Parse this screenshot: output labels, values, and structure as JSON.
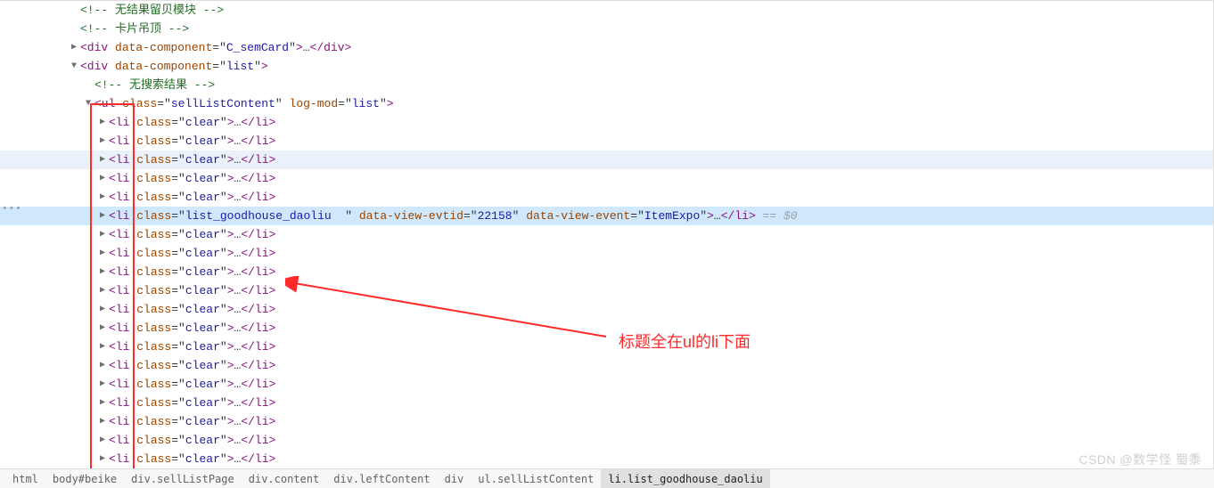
{
  "comments": {
    "c0": "<!-- 无结果留贝模块 -->",
    "c1": "<!-- 卡片吊顶 -->",
    "c2": "<!-- 无搜索结果 -->"
  },
  "nodes": {
    "div_sem": {
      "tag": "div",
      "attr": "data-component",
      "val": "C_semCard",
      "ell": "…",
      "close": "</div>"
    },
    "div_list": {
      "tag": "div",
      "attr": "data-component",
      "val": "list"
    },
    "ul": {
      "tag": "ul",
      "attrs": [
        [
          "class",
          "sellListContent"
        ],
        [
          "log-mod",
          "list"
        ]
      ]
    },
    "li_clear": {
      "tag": "li",
      "attr": "class",
      "val": "clear",
      "ell": "…",
      "close": "</li>"
    },
    "li_good": {
      "tag": "li",
      "attrs": [
        [
          "class",
          "list_goodhouse_daoliu  "
        ],
        [
          "data-view-evtid",
          "22158"
        ],
        [
          "data-view-event",
          "ItemExpo"
        ]
      ],
      "ell": "…",
      "close": "</li>",
      "suffix": " == $0"
    }
  },
  "li_count_before": 5,
  "li_count_after": 14,
  "annotation": "标题全在ul的li下面",
  "watermark": "CSDN @数学怪 蜀黍",
  "breadcrumb": [
    {
      "t": "html",
      "sel": false
    },
    {
      "t": "body#beike",
      "sel": false
    },
    {
      "t": "div.sellListPage",
      "sel": false
    },
    {
      "t": "div.content",
      "sel": false
    },
    {
      "t": "div.leftContent",
      "sel": false
    },
    {
      "t": "div",
      "sel": false
    },
    {
      "t": "ul.sellListContent",
      "sel": false
    },
    {
      "t": "li.list_goodhouse_daoliu",
      "sel": true
    }
  ]
}
